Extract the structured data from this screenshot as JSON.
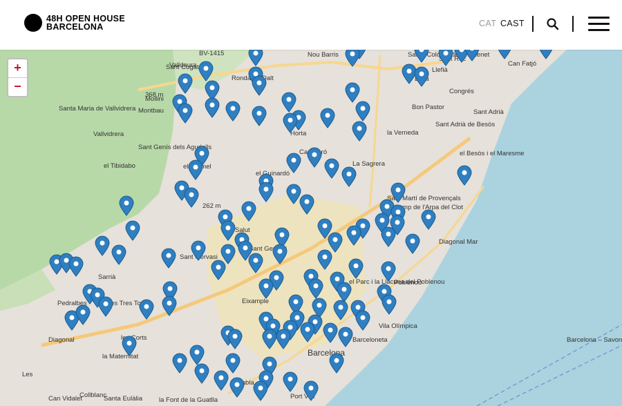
{
  "header": {
    "logo_line1": "48H OPEN HOUSE",
    "logo_line2": "BARCELONA",
    "lang_cat": "CAT",
    "lang_cast": "CAST"
  },
  "zoom": {
    "in": "+",
    "out": "−"
  },
  "colors": {
    "pin": "#2f7fc1",
    "sea": "#aad3df",
    "park": "#b7d9a8",
    "urban": "#e6e1da",
    "center": "#f2e7b8",
    "accent": "#c8102e"
  },
  "map_labels": [
    "BV-1415",
    "Nou Barris",
    "Santa Coloma de Gramenet",
    "Can Fatjó",
    "Sant Roc",
    "Sant Adrià de Besòs",
    "Montbau",
    "Sant Genís dels Agudells",
    "el Tibidabo",
    "el Carmel",
    "el Guinardó",
    "La Sagrera",
    "Sant Martí de Provençals",
    "el Camp de l'Arpa del Clot",
    "Diagonal Mar",
    "la Salut",
    "Sant Gervasi",
    "Sarrià",
    "les Tres Torres",
    "Pedralbes",
    "les Corts",
    "la Maternitat",
    "Eixample",
    "el Parc i la Llacuna del Poblenou",
    "Poblenou",
    "Vila Olímpica",
    "Barcelona",
    "Barceloneta",
    "Santa Eulàlia",
    "Collblanc",
    "Can Vidalet",
    "la Font de la Guatlla",
    "Port Vell",
    "Sant Gervasi",
    "368 m",
    "262 m",
    "Diagonal",
    "Barcelona – Savona",
    "el Besòs i el Maresme",
    "Lefia",
    "Congrés",
    "Bon Pastor",
    "la Verneda",
    "Ronda de Dalt",
    "Sant Cugat",
    "Santa Maria de Vallvidrera",
    "Mollini",
    "Vallvidrera",
    "Horta",
    "Sant Adrià",
    "Valldaura",
    "Llefià",
    "Can Baró",
    "Rambla",
    "Les"
  ]
}
